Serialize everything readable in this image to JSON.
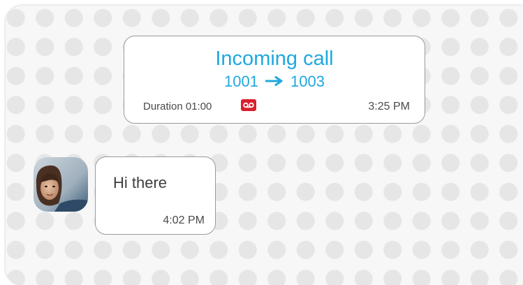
{
  "call_card": {
    "title": "Incoming call",
    "from": "1001",
    "to": "1003",
    "duration": "Duration 01:00",
    "time": "3:25 PM",
    "arrow_icon": "arrow-right-icon",
    "badge_icon": "voicemail-icon"
  },
  "message": {
    "text": "Hi there",
    "time": "4:02 PM",
    "avatar_icon": "user-avatar"
  },
  "colors": {
    "accent": "#1fa8df",
    "voicemail": "#d8202e",
    "text": "#4a4a4a",
    "panel_bg": "#f7f7f7",
    "dot": "#e6e6e6"
  }
}
